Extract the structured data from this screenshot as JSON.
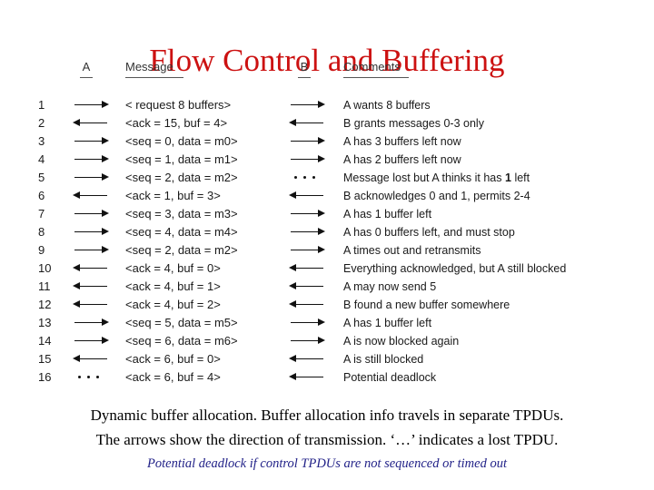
{
  "slide": {
    "title": "Flow Control and Buffering",
    "title_color": "#cc1111"
  },
  "table": {
    "headers": {
      "number": "",
      "a": "A",
      "message": "Message",
      "b": "B",
      "comments": "Comments"
    },
    "rows": [
      {
        "num": "1",
        "a": "right",
        "message": "< request 8 buffers>",
        "b": "right",
        "comment": "A wants 8 buffers"
      },
      {
        "num": "2",
        "a": "left",
        "message": "<ack = 15, buf = 4>",
        "b": "left",
        "comment": "B grants messages 0-3 only"
      },
      {
        "num": "3",
        "a": "right",
        "message": "<seq = 0, data = m0>",
        "b": "right",
        "comment": "A has 3 buffers left now"
      },
      {
        "num": "4",
        "a": "right",
        "message": "<seq = 1, data = m1>",
        "b": "right",
        "comment": "A has 2 buffers left now"
      },
      {
        "num": "5",
        "a": "right",
        "message": "<seq = 2, data = m2>",
        "b": "dots",
        "comment": "Message lost but A thinks it has 1 left",
        "comment_bold": "1"
      },
      {
        "num": "6",
        "a": "left",
        "message": "<ack = 1, buf = 3>",
        "b": "left",
        "comment": "B acknowledges 0 and 1, permits 2-4"
      },
      {
        "num": "7",
        "a": "right",
        "message": "<seq = 3, data = m3>",
        "b": "right",
        "comment": "A has 1 buffer left"
      },
      {
        "num": "8",
        "a": "right",
        "message": "<seq = 4, data = m4>",
        "b": "right",
        "comment": "A has 0 buffers left, and must stop"
      },
      {
        "num": "9",
        "a": "right",
        "message": "<seq = 2, data = m2>",
        "b": "right",
        "comment": "A times out and retransmits"
      },
      {
        "num": "10",
        "a": "left",
        "message": "<ack = 4, buf = 0>",
        "b": "left",
        "comment": "Everything acknowledged, but A still blocked"
      },
      {
        "num": "11",
        "a": "left",
        "message": "<ack = 4, buf = 1>",
        "b": "left",
        "comment": "A may now send 5"
      },
      {
        "num": "12",
        "a": "left",
        "message": "<ack = 4, buf = 2>",
        "b": "left",
        "comment": "B found a new buffer somewhere"
      },
      {
        "num": "13",
        "a": "right",
        "message": "<seq = 5, data = m5>",
        "b": "right",
        "comment": "A has 1 buffer left"
      },
      {
        "num": "14",
        "a": "right",
        "message": "<seq = 6, data = m6>",
        "b": "right",
        "comment": "A is now blocked again"
      },
      {
        "num": "15",
        "a": "left",
        "message": "<ack = 6, buf = 0>",
        "b": "left",
        "comment": "A is still blocked"
      },
      {
        "num": "16",
        "a": "dots",
        "message": "<ack = 6, buf = 4>",
        "b": "left",
        "comment": "Potential deadlock"
      }
    ]
  },
  "caption": {
    "line1": "Dynamic buffer allocation. Buffer allocation info travels in separate TPDUs.",
    "line2": "The arrows show the direction of transmission. ‘…’ indicates a lost TPDU.",
    "note": "Potential deadlock if control TPDUs are not sequenced or timed out",
    "note_color": "#222288"
  }
}
